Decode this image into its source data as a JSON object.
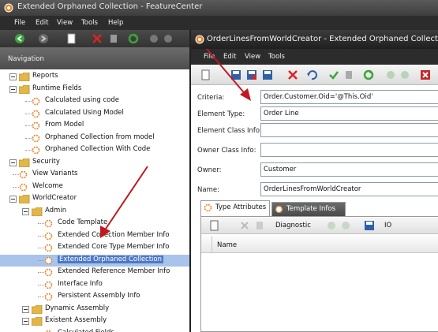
{
  "main_window": {
    "title": "Extended Orphaned Collection - FeatureCenter",
    "menu": [
      "File",
      "Edit",
      "View",
      "Tools",
      "Help"
    ]
  },
  "navigation": {
    "header": "Navigation",
    "tree": [
      {
        "label": "Reports",
        "icon": "folder-icon",
        "level": 0,
        "expander": true
      },
      {
        "label": "Runtime Fields",
        "icon": "folder-icon",
        "level": 0,
        "expander": true
      },
      {
        "label": "Calculated using code",
        "icon": "gear-icon",
        "level": 1
      },
      {
        "label": "Calculated Using Model",
        "icon": "gear-icon",
        "level": 1
      },
      {
        "label": "From Model",
        "icon": "gear-icon",
        "level": 1
      },
      {
        "label": "Orphaned Collection from model",
        "icon": "gear-icon",
        "level": 1
      },
      {
        "label": "Orphaned Collection With Code",
        "icon": "gear-icon",
        "level": 1
      },
      {
        "label": "Security",
        "icon": "folder-icon",
        "level": 0,
        "expander": true
      },
      {
        "label": "View Variants",
        "icon": "gear-icon",
        "level": 0
      },
      {
        "label": "Welcome",
        "icon": "gear-icon",
        "level": 0
      },
      {
        "label": "WorldCreator",
        "icon": "folder-icon",
        "level": 0,
        "expander": true
      },
      {
        "label": "Admin",
        "icon": "folder-icon",
        "level": 1,
        "expander": true
      },
      {
        "label": "Code Template",
        "icon": "gear-icon",
        "level": 2
      },
      {
        "label": "Extended Collection Member Info",
        "icon": "gear-icon",
        "level": 2
      },
      {
        "label": "Extended Core Type Member Info",
        "icon": "gear-icon",
        "level": 2
      },
      {
        "label": "Extended Orphaned Collection",
        "icon": "gear-icon",
        "level": 2,
        "selected": true
      },
      {
        "label": "Extended Reference Member Info",
        "icon": "gear-icon",
        "level": 2
      },
      {
        "label": "Interface Info",
        "icon": "gear-icon",
        "level": 2
      },
      {
        "label": "Persistent Assembly Info",
        "icon": "gear-icon",
        "level": 2
      },
      {
        "label": "Dynamic Assembly",
        "icon": "folder-icon",
        "level": 1,
        "expander": true
      },
      {
        "label": "Existent Assembly",
        "icon": "folder-icon",
        "level": 1,
        "expander": true
      },
      {
        "label": "Calculated Fields",
        "icon": "gear-icon",
        "level": 2
      }
    ]
  },
  "detail_window": {
    "title": "OrderLinesFromWorldCreator - Extended Orphaned Collection",
    "menu": [
      "File",
      "Edit",
      "View",
      "Tools"
    ],
    "fields": [
      {
        "label": "Criteria:",
        "value": "Order.Customer.Oid='@This.Oid'"
      },
      {
        "label": "Element Type:",
        "value": "Order Line"
      },
      {
        "label": "Element Class Info:",
        "value": ""
      },
      {
        "label": "Owner Class Info:",
        "value": ""
      },
      {
        "label": "Owner:",
        "value": "Customer"
      },
      {
        "label": "Name:",
        "value": "OrderLinesFromWorldCreator"
      }
    ],
    "tabs": [
      {
        "label": "Type Attributes",
        "active": true
      },
      {
        "label": "Template Infos",
        "active": false
      }
    ],
    "sub_toolbar": {
      "diagnostic": "Diagnostic",
      "io": "IO"
    },
    "grid": {
      "columns": [
        "Name"
      ]
    }
  },
  "colors": {
    "accent_arrow": "#c0191f",
    "selection": "#4e79c5"
  }
}
